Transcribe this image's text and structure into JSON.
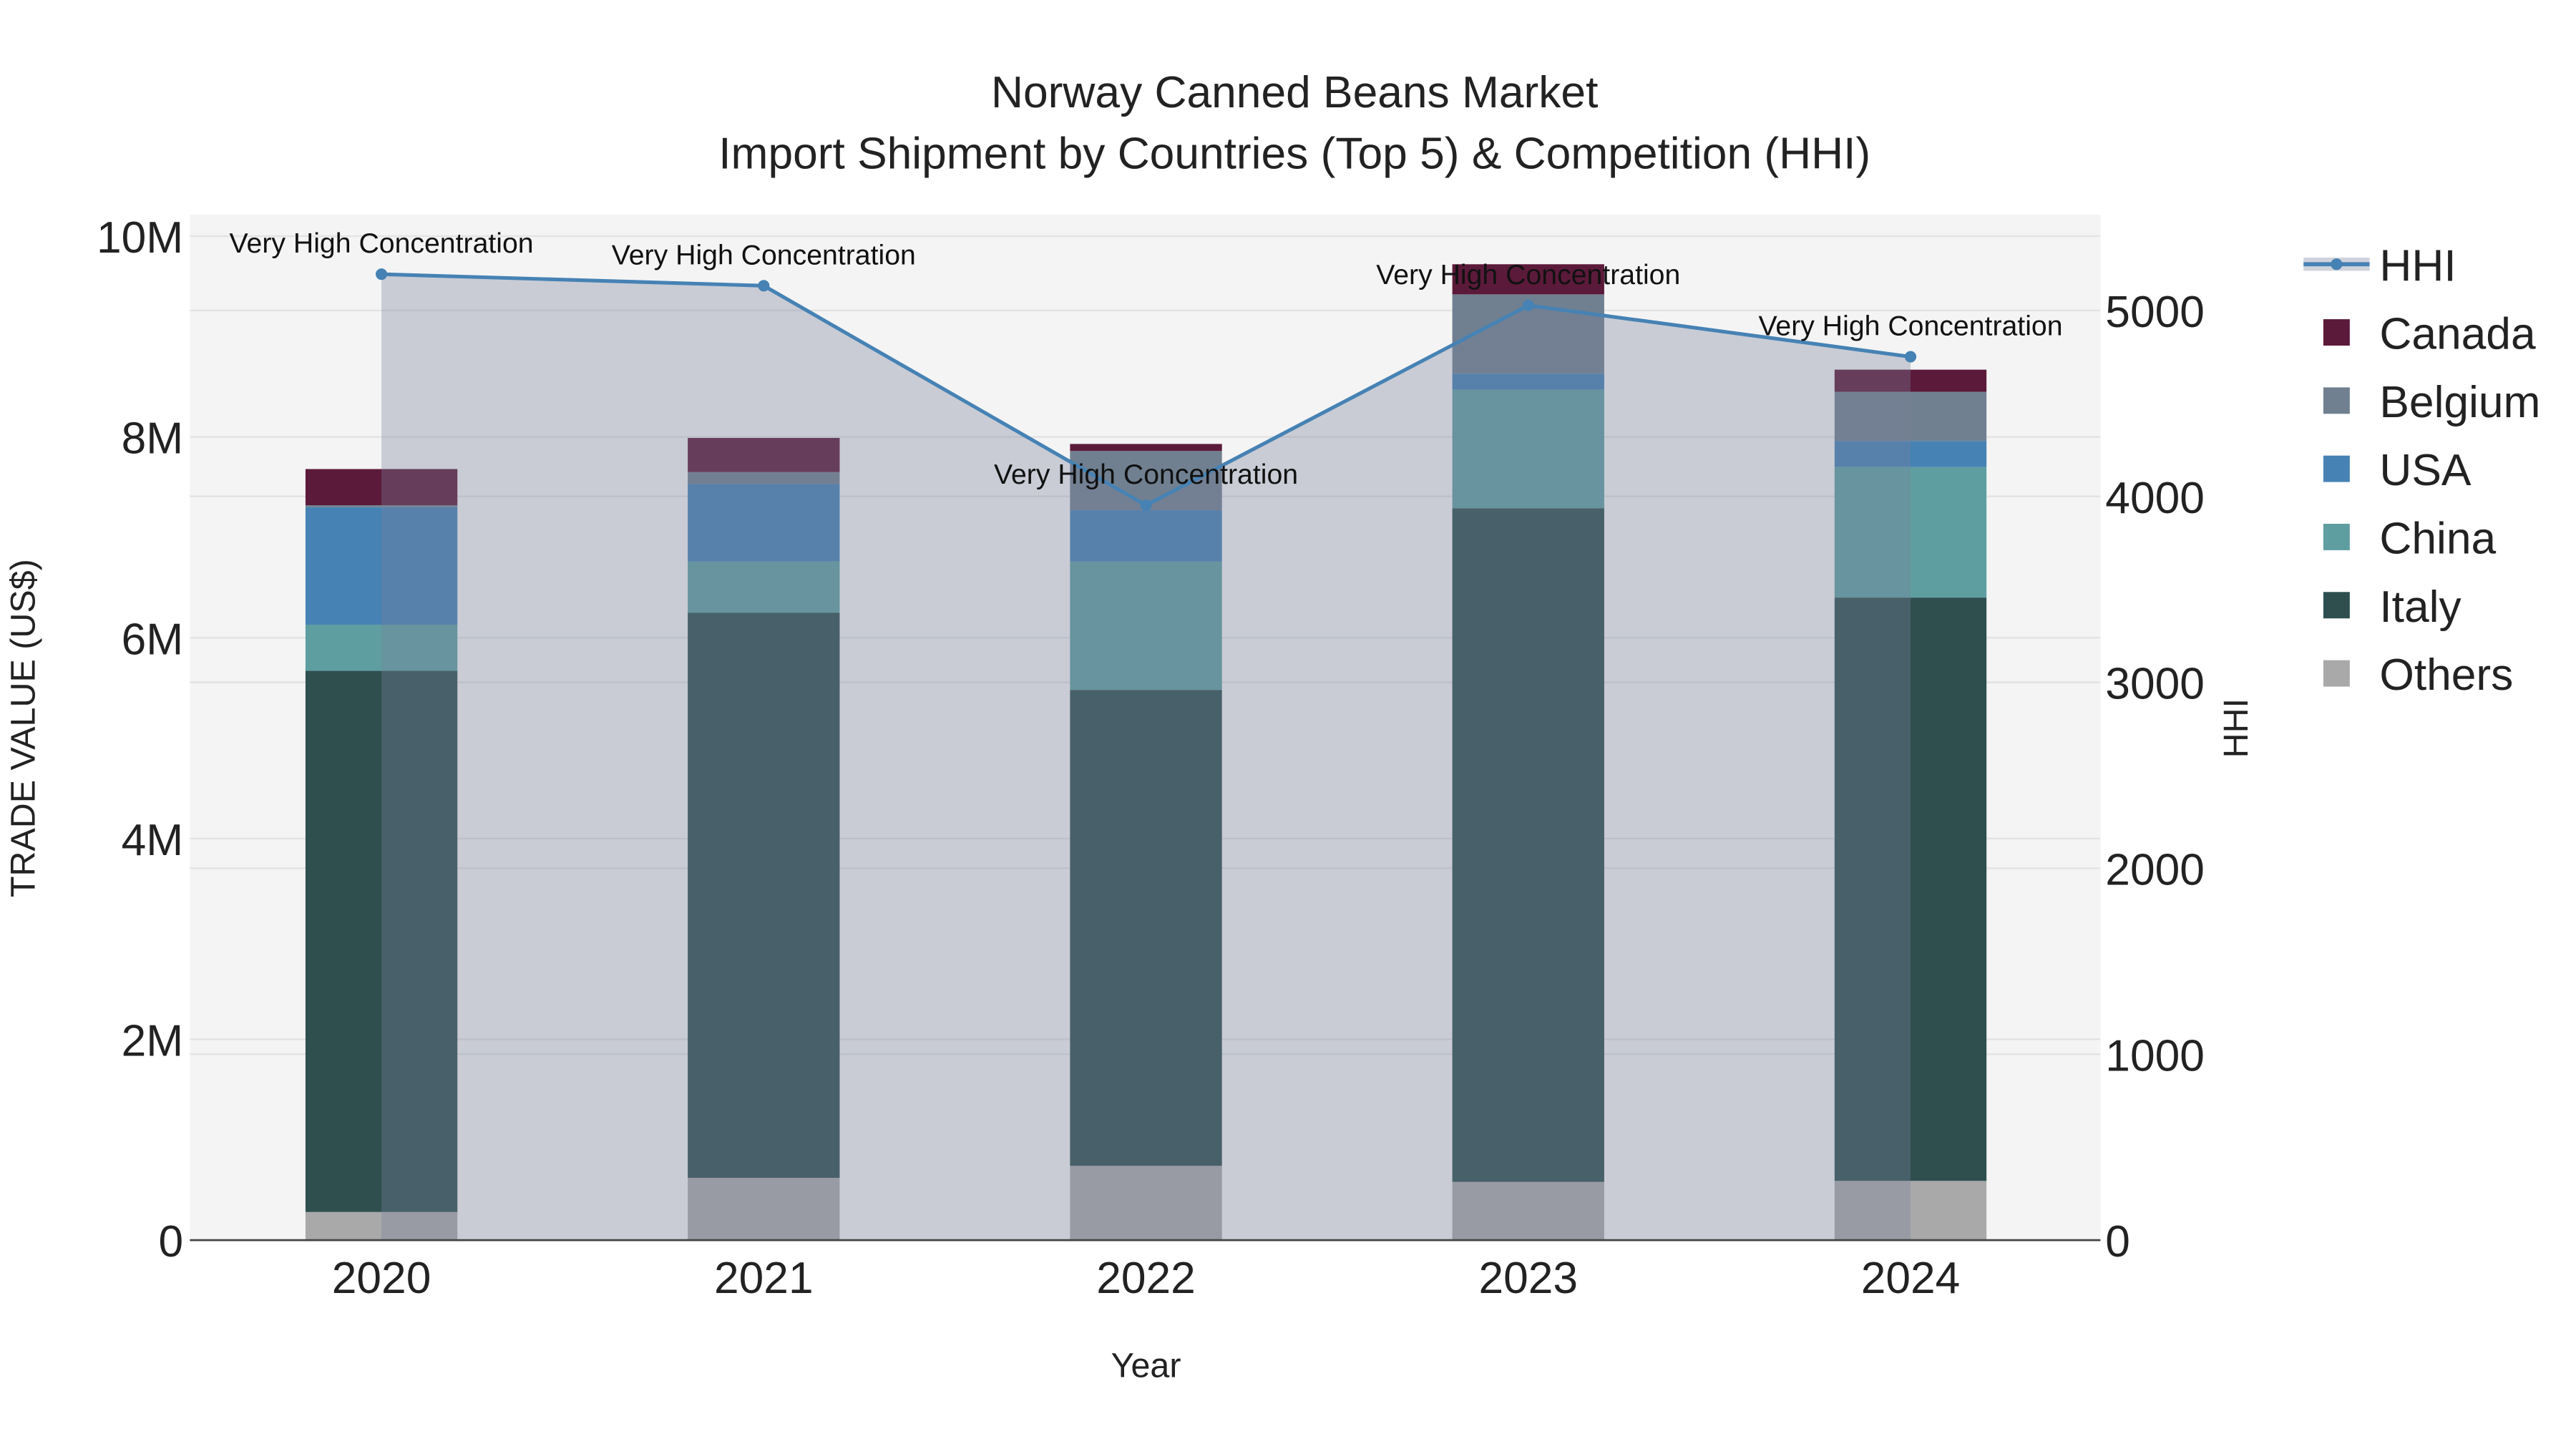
{
  "chart_data": {
    "type": "bar",
    "stacked": true,
    "title": "Norway Canned Beans Market",
    "subtitle": "Import Shipment by Countries (Top 5) & Competition (HHI)",
    "xlabel": "Year",
    "ylabel": "TRADE VALUE (US$)",
    "y2label": "HHI",
    "categories": [
      "2020",
      "2021",
      "2022",
      "2023",
      "2024"
    ],
    "ylim": [
      0,
      10000000
    ],
    "y2lim": [
      0,
      5500
    ],
    "yticks": [
      {
        "v": 0,
        "label": "0"
      },
      {
        "v": 2000000,
        "label": "2M"
      },
      {
        "v": 4000000,
        "label": "4M"
      },
      {
        "v": 6000000,
        "label": "6M"
      },
      {
        "v": 8000000,
        "label": "8M"
      },
      {
        "v": 10000000,
        "label": "10M"
      }
    ],
    "y2ticks": [
      {
        "v": 0,
        "label": "0"
      },
      {
        "v": 1000,
        "label": "1000"
      },
      {
        "v": 2000,
        "label": "2000"
      },
      {
        "v": 3000,
        "label": "3000"
      },
      {
        "v": 4000,
        "label": "4000"
      },
      {
        "v": 5000,
        "label": "5000"
      }
    ],
    "series": [
      {
        "name": "Others",
        "color": "#a9a9a9",
        "values": [
          280000,
          620000,
          740000,
          580000,
          590000
        ]
      },
      {
        "name": "Italy",
        "color": "#2f4f4f",
        "values": [
          5390000,
          5630000,
          4740000,
          6710000,
          5810000
        ]
      },
      {
        "name": "China",
        "color": "#5f9ea0",
        "values": [
          460000,
          510000,
          1280000,
          1180000,
          1300000
        ]
      },
      {
        "name": "USA",
        "color": "#4682b4",
        "values": [
          1170000,
          770000,
          510000,
          160000,
          260000
        ]
      },
      {
        "name": "Belgium",
        "color": "#708090",
        "values": [
          20000,
          120000,
          590000,
          790000,
          490000
        ]
      },
      {
        "name": "Canada",
        "color": "#5c1a3a",
        "values": [
          360000,
          340000,
          70000,
          300000,
          220000
        ]
      }
    ],
    "line": {
      "name": "HHI",
      "color": "#4682b4",
      "values": [
        5195,
        5133,
        3952,
        5027,
        4751
      ]
    },
    "annotations": [
      "Very High Concentration",
      "Very High Concentration",
      "Very High Concentration",
      "Very High Concentration",
      "Very High Concentration"
    ],
    "legend": {
      "placement": "right",
      "order": [
        "HHI",
        "Canada",
        "Belgium",
        "USA",
        "China",
        "Italy",
        "Others"
      ]
    },
    "grid": true
  }
}
